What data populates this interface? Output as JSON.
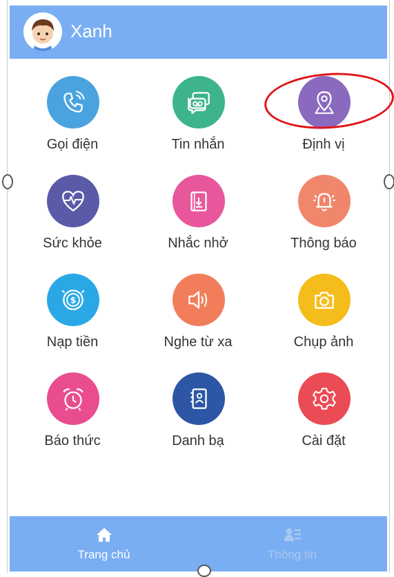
{
  "header": {
    "title": "Xanh",
    "avatar_icon": "boy-avatar-icon",
    "background": "#7aaef3"
  },
  "grid": {
    "items": [
      {
        "label": "Gọi điện",
        "icon": "phone-icon",
        "color": "#4aa3df"
      },
      {
        "label": "Tin nhắn",
        "icon": "message-icon",
        "color": "#3db48a"
      },
      {
        "label": "Định vị",
        "icon": "location-pin-icon",
        "color": "#8a6abf"
      },
      {
        "label": "Sức khỏe",
        "icon": "heart-pulse-icon",
        "color": "#5a5aa8"
      },
      {
        "label": "Nhắc nhở",
        "icon": "reminder-icon",
        "color": "#e8579b"
      },
      {
        "label": "Thông báo",
        "icon": "bell-icon",
        "color": "#f0866b"
      },
      {
        "label": "Nạp tiền",
        "icon": "coin-icon",
        "color": "#2aa8e6"
      },
      {
        "label": "Nghe từ xa",
        "icon": "speaker-icon",
        "color": "#f27d5b"
      },
      {
        "label": "Chụp ảnh",
        "icon": "camera-icon",
        "color": "#f5bd1c"
      },
      {
        "label": "Báo thức",
        "icon": "alarm-clock-icon",
        "color": "#ea4d8f"
      },
      {
        "label": "Danh bạ",
        "icon": "contacts-icon",
        "color": "#2d57a5"
      },
      {
        "label": "Cài đặt",
        "icon": "gear-icon",
        "color": "#ea4b55"
      }
    ]
  },
  "bottom_nav": {
    "items": [
      {
        "label": "Trang chủ",
        "icon": "home-icon",
        "active": true
      },
      {
        "label": "Thông tin",
        "icon": "profile-list-icon",
        "active": false
      }
    ]
  },
  "colors": {
    "highlight": "#e0141a",
    "nav_active": "#ffffff",
    "nav_inactive": "#a9c8f1"
  }
}
